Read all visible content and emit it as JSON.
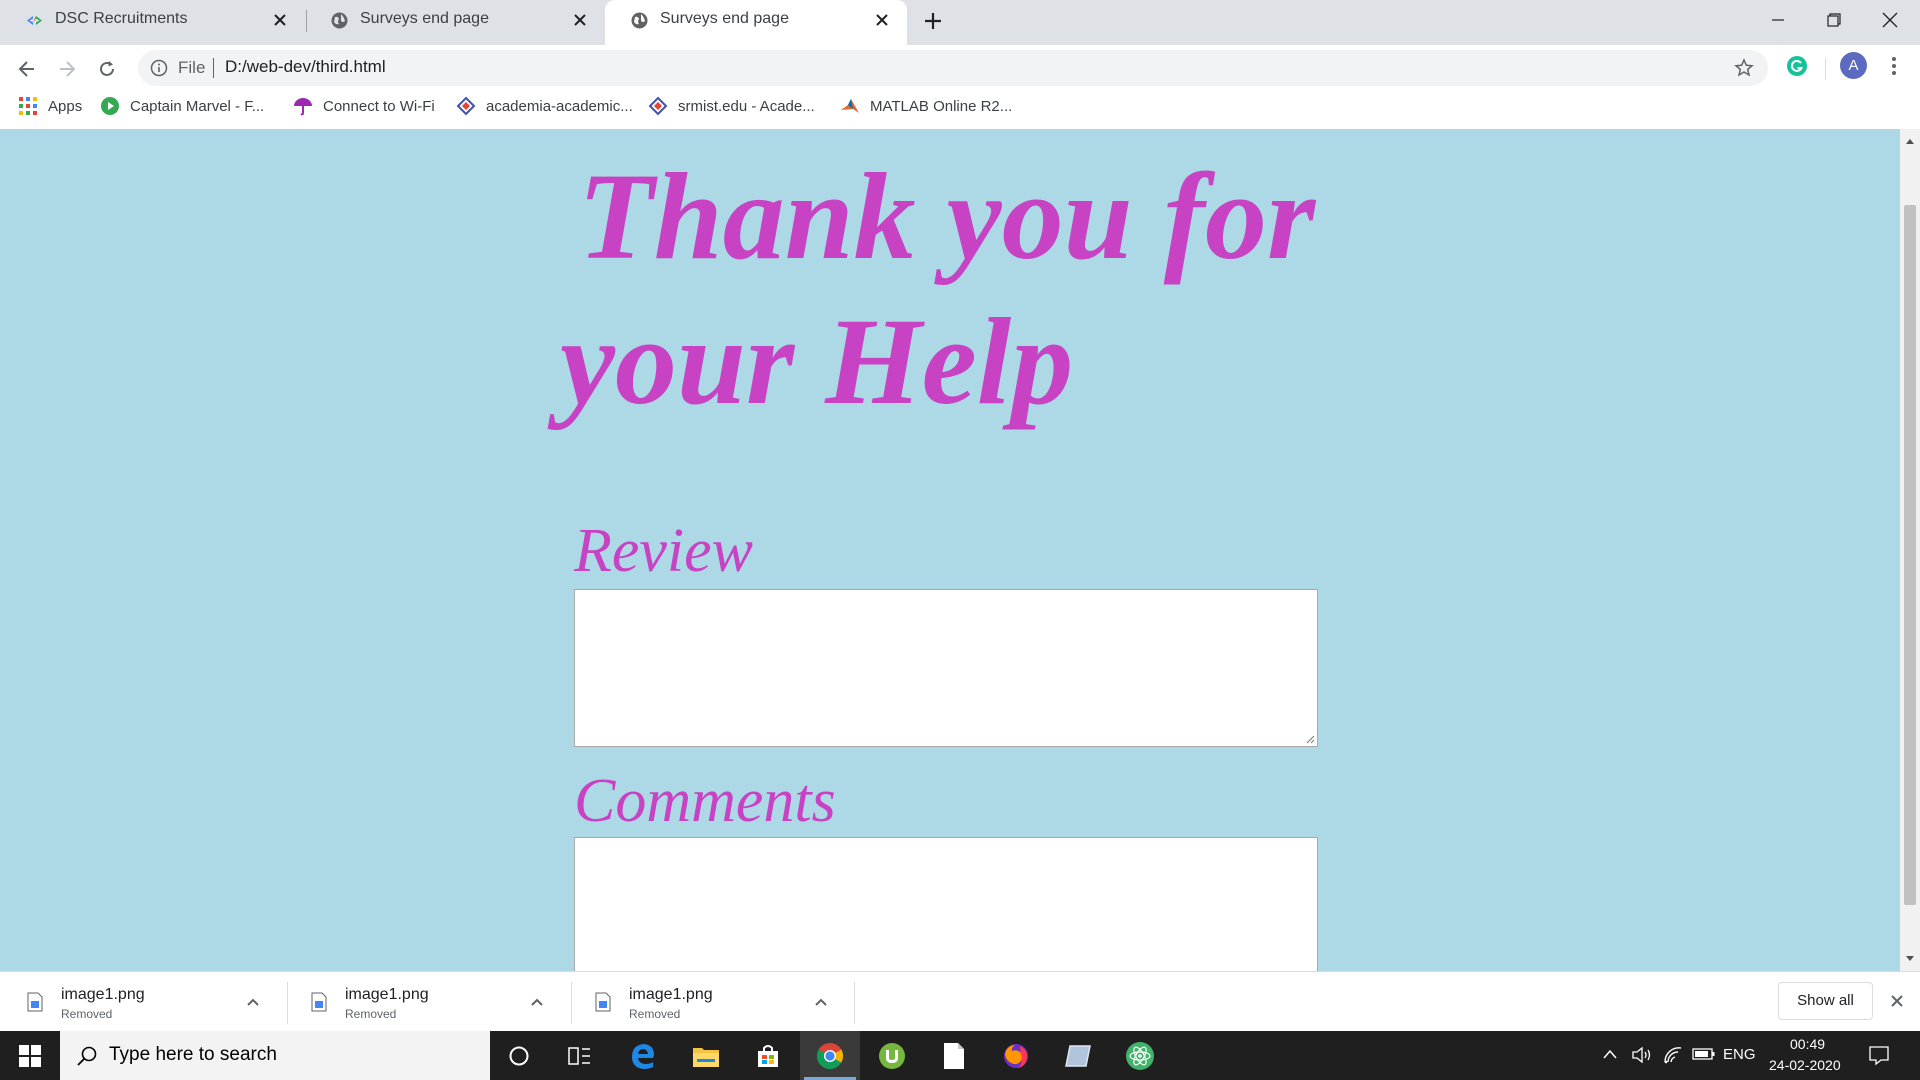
{
  "browser": {
    "tabs": [
      {
        "title": "DSC Recruitments",
        "icon": "google-dev-icon",
        "active": false
      },
      {
        "title": "Surveys end page",
        "icon": "globe-icon",
        "active": false
      },
      {
        "title": "Surveys end page",
        "icon": "globe-icon",
        "active": true
      }
    ],
    "new_tab": "+",
    "address": {
      "info_label": "File",
      "url": "D:/web-dev/third.html"
    },
    "profile_initial": "A",
    "bookmarks": [
      {
        "label": "Apps",
        "icon": "apps-grid-icon"
      },
      {
        "label": "Captain Marvel - F...",
        "icon": "play-icon"
      },
      {
        "label": "Connect to Wi-Fi",
        "icon": "umbrella-icon"
      },
      {
        "label": "academia-academic...",
        "icon": "diamond-icon"
      },
      {
        "label": "srmist.edu - Acade...",
        "icon": "diamond-icon"
      },
      {
        "label": "MATLAB Online R2...",
        "icon": "matlab-icon"
      }
    ]
  },
  "page": {
    "heading_line1": "Thank you for",
    "heading_line2": "your Help",
    "review_label": "Review",
    "comments_label": "Comments",
    "heading_color": "#c843c4",
    "background_color": "#add8e6"
  },
  "downloads": {
    "items": [
      {
        "name": "image1.png",
        "status": "Removed"
      },
      {
        "name": "image1.png",
        "status": "Removed"
      },
      {
        "name": "image1.png",
        "status": "Removed"
      }
    ],
    "show_all": "Show all"
  },
  "taskbar": {
    "search_placeholder": "Type here to search",
    "language": "ENG",
    "time": "00:49",
    "date": "24-02-2020"
  }
}
